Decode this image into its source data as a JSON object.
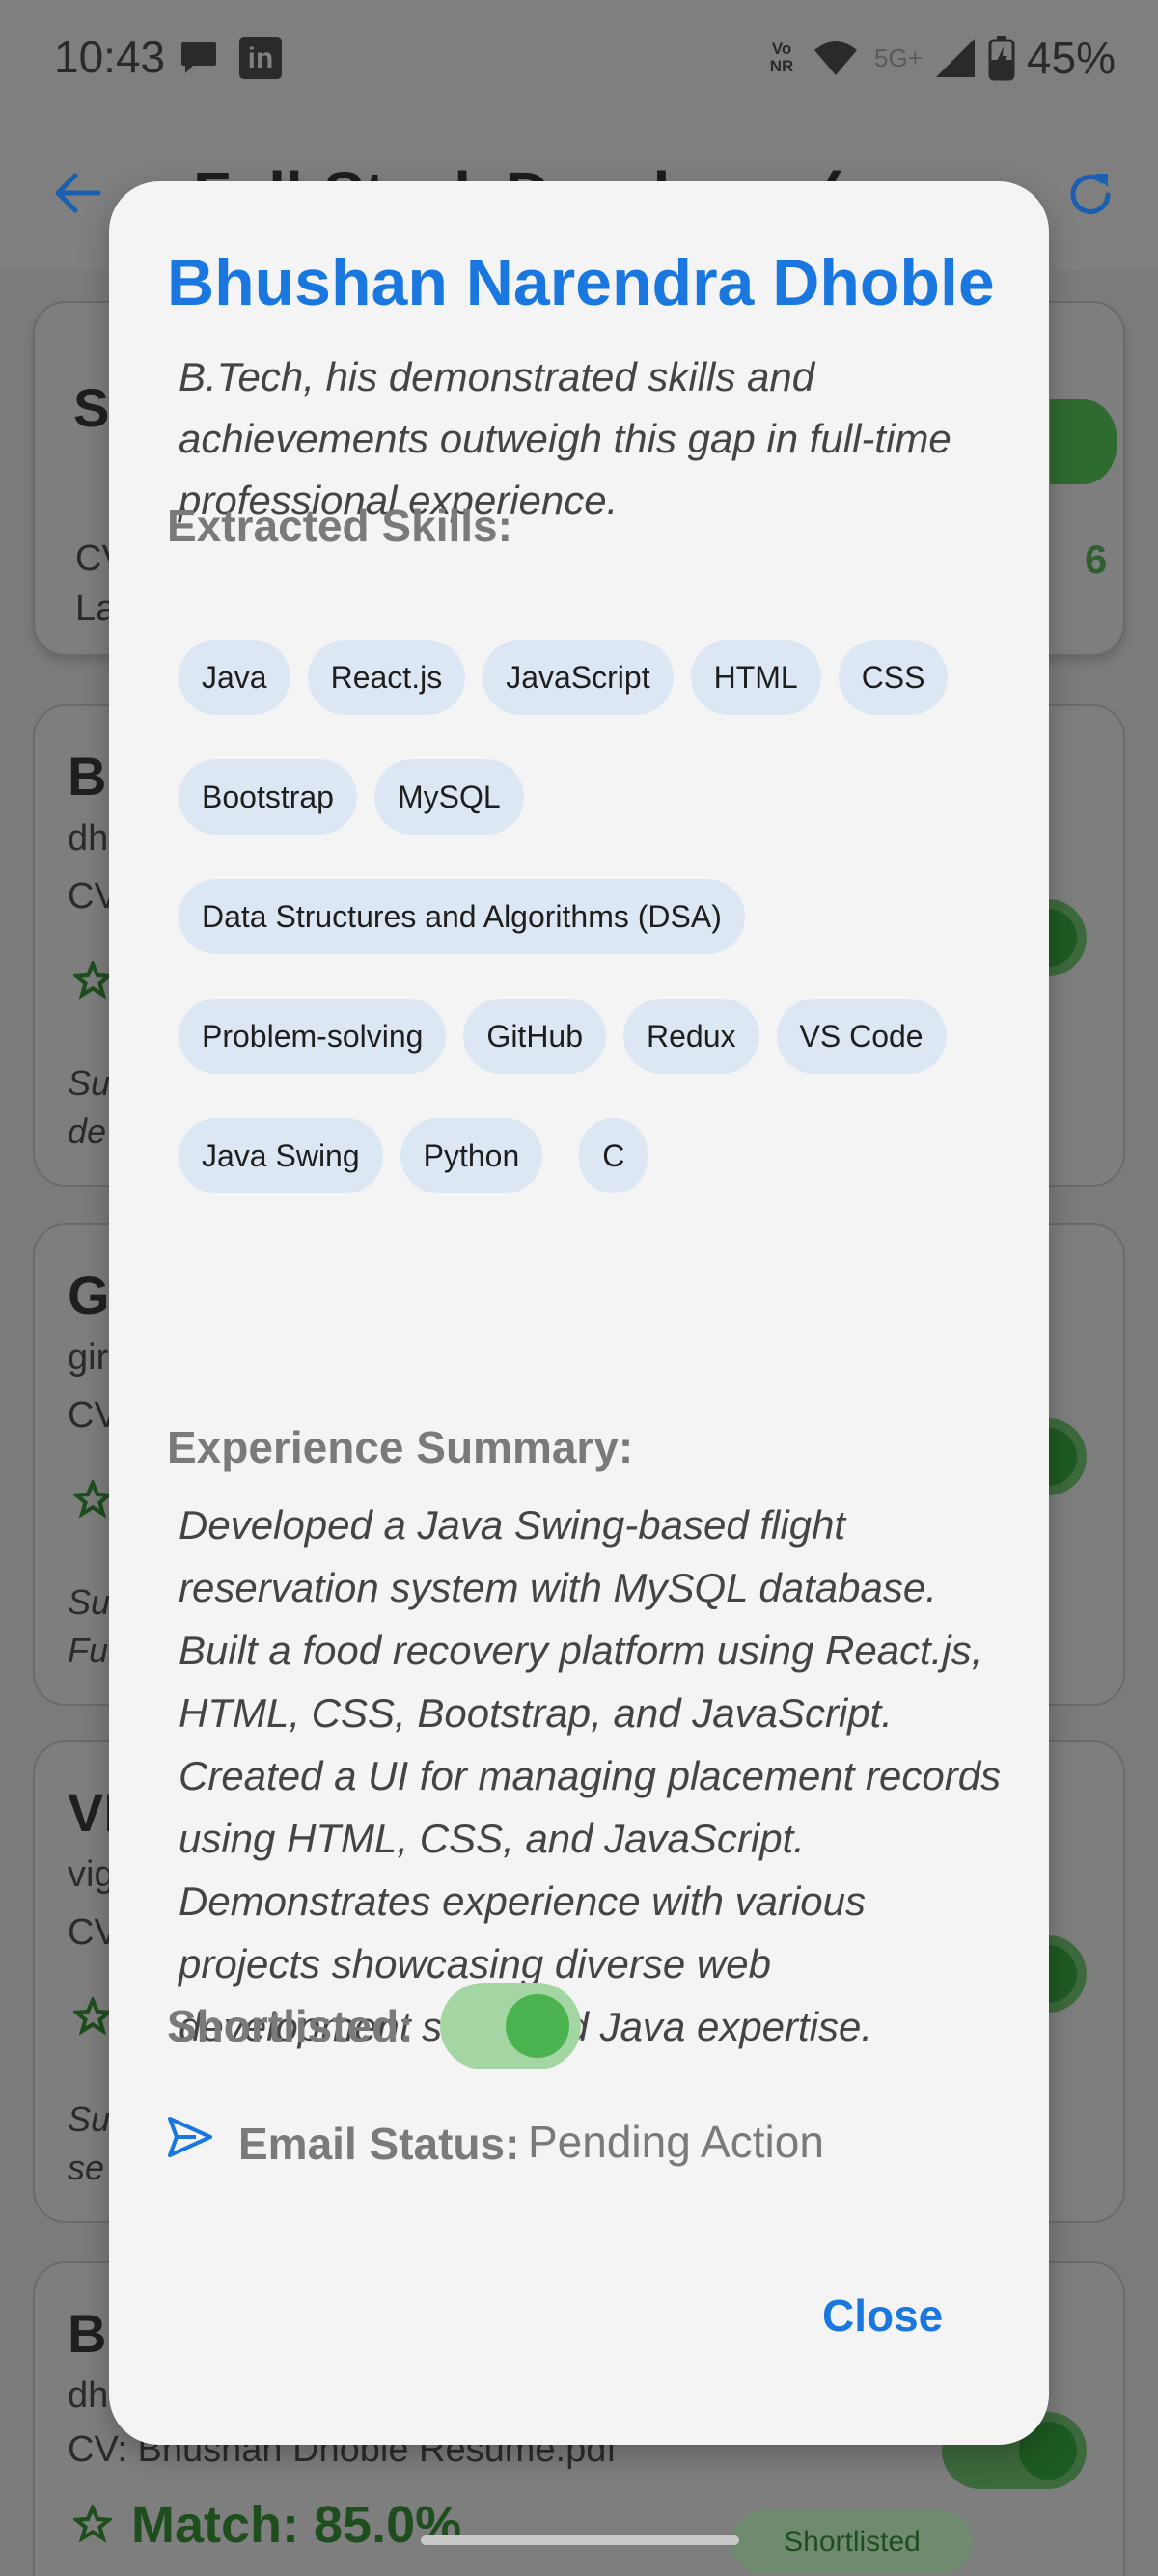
{
  "status_bar": {
    "time": "10:43",
    "volte": "Vo\nNR",
    "network": "5G+",
    "battery": "45%"
  },
  "app_bar": {
    "title": "Full-Stack Developer ( Jav",
    "back_icon": "back-arrow-icon",
    "refresh_icon": "refresh-icon"
  },
  "background": {
    "summary_card": {
      "title_start": "S",
      "line1_start": "CV",
      "line2_start": "La",
      "count_end": "6"
    },
    "cards": [
      {
        "name_start": "Bl",
        "email_start": "dh",
        "cv_start": "CV",
        "summary_start_1": "Su",
        "summary_start_2": "de"
      },
      {
        "name_start": "Gi",
        "email_start": "gir",
        "cv_start": "CV",
        "summary_start_1": "Su",
        "summary_start_2": "Fu"
      },
      {
        "name_start": "VI",
        "email_start": "vig",
        "cv_start": "CV",
        "summary_start_1": "Su",
        "summary_start_2": "se"
      },
      {
        "name_start": "Bl",
        "email_start": "dh",
        "cv": "CV: Bhushan Dhoble Resume.pdf",
        "match": "Match: 85.0%",
        "badge": "Shortlisted"
      }
    ]
  },
  "dialog": {
    "title": "Bhushan Narendra Dhoble",
    "clipped_text": "B.Tech, his demonstrated skills and achievements outweigh this gap in full-time professional experience.",
    "skills_heading": "Extracted Skills:",
    "skill_rows": [
      [
        "Java",
        "React.js",
        "JavaScript",
        "HTML",
        "CSS"
      ],
      [
        "Bootstrap",
        "MySQL"
      ],
      [
        "Data Structures and Algorithms (DSA)"
      ],
      [
        "Problem-solving",
        "GitHub",
        "Redux",
        "VS Code"
      ],
      [
        "Java Swing",
        "Python",
        "C"
      ]
    ],
    "experience_heading": "Experience Summary:",
    "experience_text": "Developed a Java Swing-based flight reservation system with MySQL database.  Built a food recovery platform using React.js, HTML, CSS, Bootstrap, and JavaScript. Created a UI for managing placement records using HTML, CSS, and JavaScript. Demonstrates experience with various projects showcasing diverse web development skills and Java expertise.",
    "shortlisted_label": "Shortlisted:",
    "shortlisted": true,
    "email_status_label": "Email Status:",
    "email_status_value": "Pending Action",
    "close_label": "Close"
  },
  "colors": {
    "accent": "#1977df",
    "toggle_track": "#a4d6a4",
    "toggle_knob": "#4ab24e",
    "chip_bg": "#dde7f3",
    "dialog_bg": "#f4f4f4",
    "scrim": "#7b7b7b"
  }
}
